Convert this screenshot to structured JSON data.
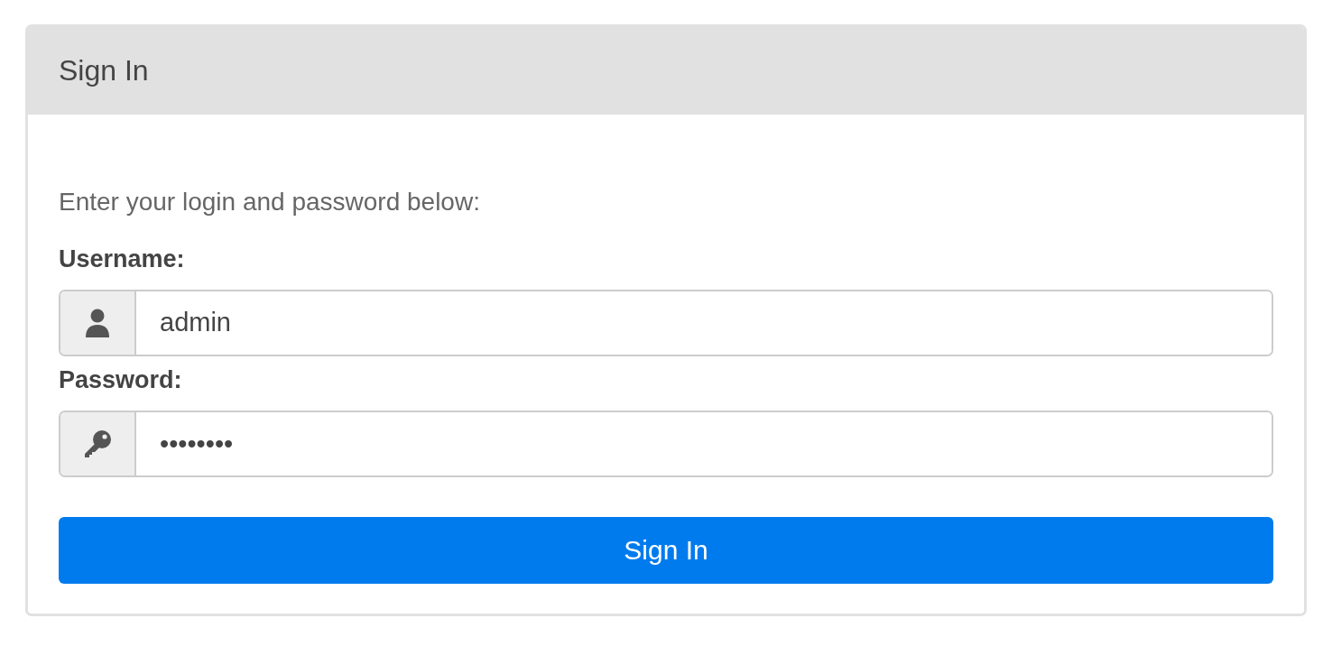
{
  "panel": {
    "title": "Sign In"
  },
  "instructions": "Enter your login and password below:",
  "fields": [
    {
      "label": "Username:",
      "kind": "user",
      "value": "admin"
    },
    {
      "label": "Password:",
      "kind": "key",
      "value": "••••••••"
    }
  ],
  "button": {
    "label": "Sign In"
  }
}
